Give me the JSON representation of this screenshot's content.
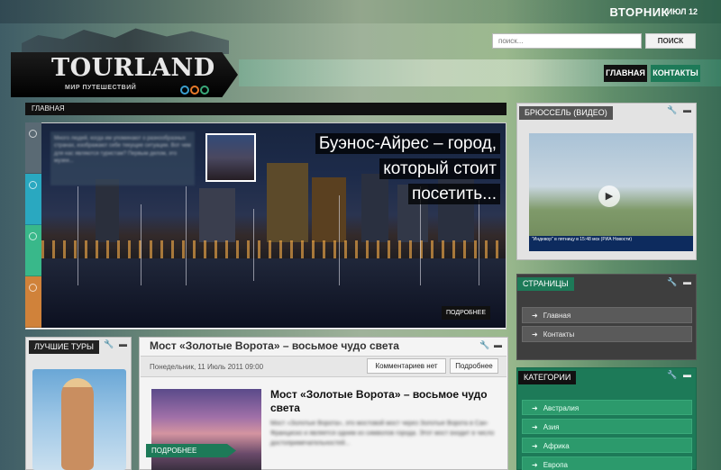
{
  "header": {
    "day": "ВТОРНИК",
    "date": "ИЮЛ 12",
    "search": {
      "placeholder": "поиск...",
      "button": "ПОИСК"
    }
  },
  "logo": {
    "title": "TOURLAND",
    "subtitle": "МИР ПУТЕШЕСТВИЙ"
  },
  "nav": [
    {
      "label": "ГЛАВНАЯ"
    },
    {
      "label": "КОНТАКТЫ"
    }
  ],
  "breadcrumb": "ГЛАВНАЯ",
  "slider": {
    "title_lines": [
      "Буэнос-Айрес – город,",
      "который стоит",
      "посетить..."
    ],
    "intro": "Много людей, когда им упоминают о разнообразных странах, изображают себе текущие ситуации. Вот чем для нас являются туристам? Первым делом, это музеи...",
    "more": "ПОДРОБНЕЕ"
  },
  "best_tours": {
    "title": "ЛУЧШИЕ ТУРЫ"
  },
  "post": {
    "header_title": "Мост «Золотые Ворота» – восьмое чудо света",
    "date": "Понедельник, 11 Июль 2011 09:00",
    "comments_button": "Комментариев нет",
    "more_button": "Подробнее",
    "heading": "Мост «Золотые Ворота» – восьмое чудо света",
    "excerpt": "Мост «Золотые Ворота», это мостовой мост через Золотые Ворота в Сан-Франциско и является одним из символов города. Этот мост входит в число достопримечательностей...",
    "thumb_more": "ПОДРОБНЕЕ"
  },
  "sidebar": {
    "video": {
      "title": "БРЮССЕЛЬ (ВИДЕО)",
      "ticker": "\"Индевор\" в пятницу в 15:48 мск (РИА Новости)"
    },
    "pages": {
      "title": "СТРАНИЦЫ",
      "items": [
        "Главная",
        "Контакты"
      ]
    },
    "categories": {
      "title": "КАТЕГОРИИ",
      "items": [
        "Австралия",
        "Азия",
        "Африка",
        "Европа"
      ]
    }
  },
  "colors": {
    "accent_green": "#1d7a58",
    "dark": "#111111"
  }
}
